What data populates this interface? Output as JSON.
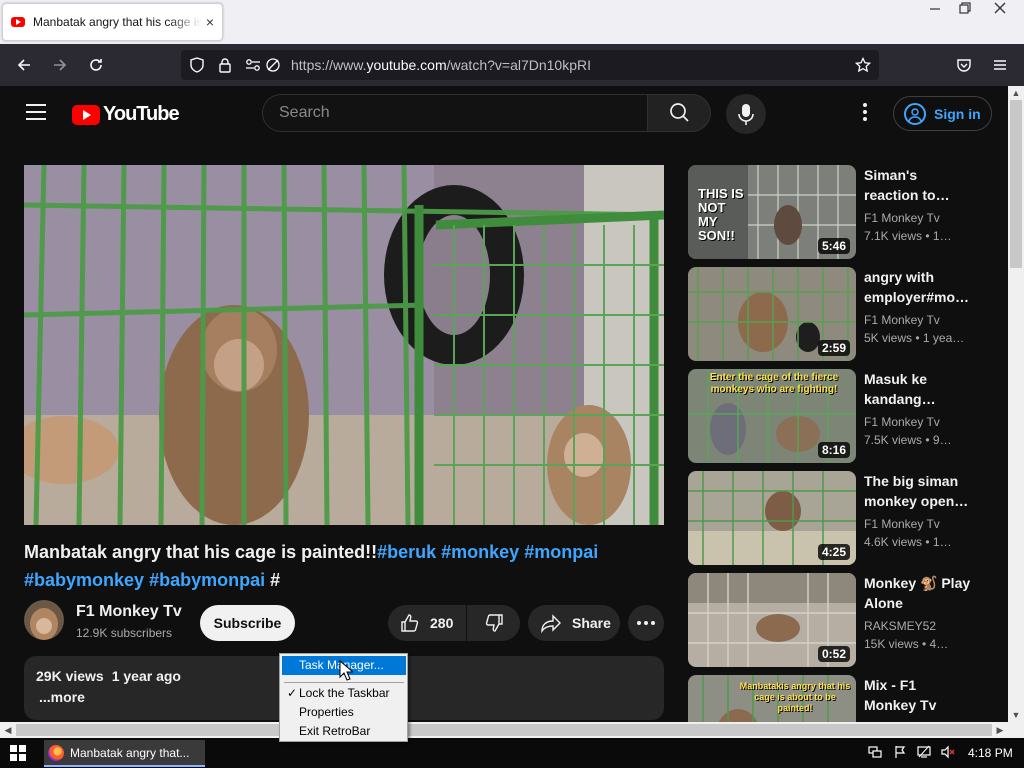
{
  "browser": {
    "tab_title": "Manbatak angry that his cage is painted!!#beruk #monkey #monpai #babymonkey #babymonpai #",
    "tab_close": "×",
    "url_prefix": "https://www.",
    "url_domain": "youtube.com",
    "url_path": "/watch?v=al7Dn10kpRI"
  },
  "yt": {
    "logo_text": "YouTube",
    "search_placeholder": "Search",
    "sign_in": "Sign in",
    "video": {
      "title_plain": "Manbatak angry that his cage is painted!!",
      "tag1": "#beruk",
      "tag2": "#monkey",
      "tag3": "#monpai",
      "tag4": "#babymonkey",
      "tag5": "#babymonpai",
      "tag6": "#"
    },
    "channel": {
      "name": "F1 Monkey Tv",
      "subs": "12.9K subscribers"
    },
    "subscribe": "Subscribe",
    "likes": "280",
    "share": "Share",
    "views": "29K views",
    "age": "1 year ago",
    "more": "...more",
    "recs": [
      {
        "title": "Siman's reaction to…",
        "channel": "F1 Monkey Tv",
        "meta": "7.1K views • 1…",
        "duration": "5:46"
      },
      {
        "title": "angry with employer#mo…",
        "channel": "F1 Monkey Tv",
        "meta": "5K views • 1 yea…",
        "duration": "2:59"
      },
      {
        "title": "Masuk ke kandang…",
        "channel": "F1 Monkey Tv",
        "meta": "7.5K views • 9…",
        "duration": "8:16"
      },
      {
        "title": "The big siman monkey open…",
        "channel": "F1 Monkey Tv",
        "meta": "4.6K views • 1…",
        "duration": "4:25"
      },
      {
        "title": "Monkey 🐒 Play Alone",
        "channel": "RAKSMEY52",
        "meta": "15K views • 4…",
        "duration": "0:52"
      },
      {
        "title": "Mix - F1 Monkey Tv",
        "channel": "",
        "meta": "",
        "duration": ""
      }
    ],
    "thumb_texts": {
      "r1": "THIS IS NOT MY SON!!",
      "r3": "Enter the cage of the fierce monkeys who are fighting!",
      "r6": "Manbatakis angry that his cage is about to be painted!"
    }
  },
  "taskbar": {
    "item": "Manbatak angry that...",
    "clock": "4:18 PM"
  },
  "context_menu": {
    "task_manager": "Task Manager...",
    "lock": "Lock the Taskbar",
    "properties": "Properties",
    "exit": "Exit RetroBar",
    "check": "✓"
  }
}
